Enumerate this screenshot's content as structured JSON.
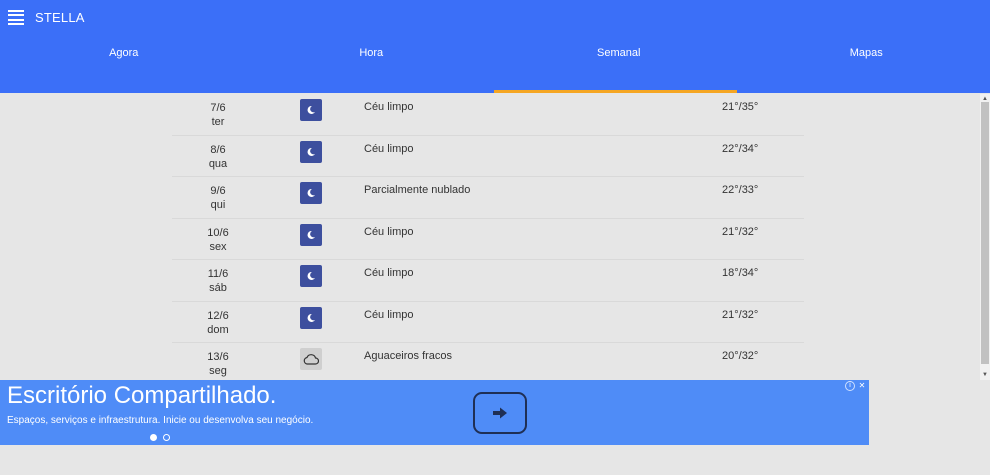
{
  "app": {
    "title": "STELLA"
  },
  "tabs": [
    {
      "label": "Agora"
    },
    {
      "label": "Hora"
    },
    {
      "label": "Semanal"
    },
    {
      "label": "Mapas"
    }
  ],
  "active_tab": "Semanal",
  "forecast": [
    {
      "date": "7/6",
      "day": "ter",
      "icon": "moon-icon",
      "condition": "Céu limpo",
      "temp": "21°/35°"
    },
    {
      "date": "8/6",
      "day": "qua",
      "icon": "moon-icon",
      "condition": "Céu limpo",
      "temp": "22°/34°"
    },
    {
      "date": "9/6",
      "day": "qui",
      "icon": "moon-icon",
      "condition": "Parcialmente nublado",
      "temp": "22°/33°"
    },
    {
      "date": "10/6",
      "day": "sex",
      "icon": "moon-icon",
      "condition": "Céu limpo",
      "temp": "21°/32°"
    },
    {
      "date": "11/6",
      "day": "sáb",
      "icon": "moon-icon",
      "condition": "Céu limpo",
      "temp": "18°/34°"
    },
    {
      "date": "12/6",
      "day": "dom",
      "icon": "moon-icon",
      "condition": "Céu limpo",
      "temp": "21°/32°"
    },
    {
      "date": "13/6",
      "day": "seg",
      "icon": "cloud-icon",
      "condition": "Aguaceiros fracos",
      "temp": "20°/32°"
    }
  ],
  "ad": {
    "title": "Escritório Compartilhado.",
    "subtitle": "Espaços, serviços e infraestrutura. Inicie ou desenvolva seu negócio."
  },
  "colors": {
    "appbar": "#3b6ff8",
    "tab_indicator": "#f5a623",
    "ad_background": "#4f8cf7",
    "icon_night": "#3d4f9e"
  }
}
